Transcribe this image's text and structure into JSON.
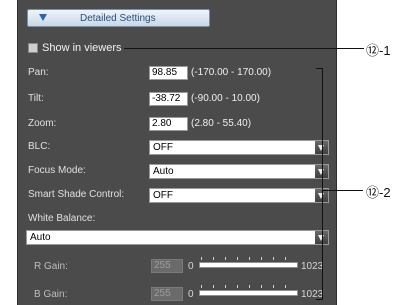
{
  "section": {
    "title": "Detailed Settings"
  },
  "show_in_viewers": {
    "label": "Show in viewers",
    "checked": false
  },
  "pan": {
    "label": "Pan:",
    "value": "98.85",
    "range": "(-170.00 - 170.00)"
  },
  "tilt": {
    "label": "Tilt:",
    "value": "-38.72",
    "range": "(-90.00 - 10.00)"
  },
  "zoom": {
    "label": "Zoom:",
    "value": "2.80",
    "range": "(2.80 - 55.40)"
  },
  "blc": {
    "label": "BLC:",
    "value": "OFF"
  },
  "focus_mode": {
    "label": "Focus Mode:",
    "value": "Auto"
  },
  "smart_shade": {
    "label": "Smart Shade Control:",
    "value": "OFF"
  },
  "white_balance": {
    "label": "White Balance:",
    "value": "Auto"
  },
  "r_gain": {
    "label": "R Gain:",
    "value": "255",
    "min": "0",
    "max": "1023"
  },
  "b_gain": {
    "label": "B Gain:",
    "value": "255",
    "min": "0",
    "max": "1023"
  },
  "callouts": {
    "first": "⑫-1",
    "second": "⑫-2"
  },
  "colors": {
    "panel_bg": "#4b4b4b",
    "header_text": "#2d4e7a",
    "header_arrow": "#2d63a8"
  },
  "icons": {
    "section_toggle": "triangle-down-icon",
    "dropdown": "chevron-down-icon"
  }
}
